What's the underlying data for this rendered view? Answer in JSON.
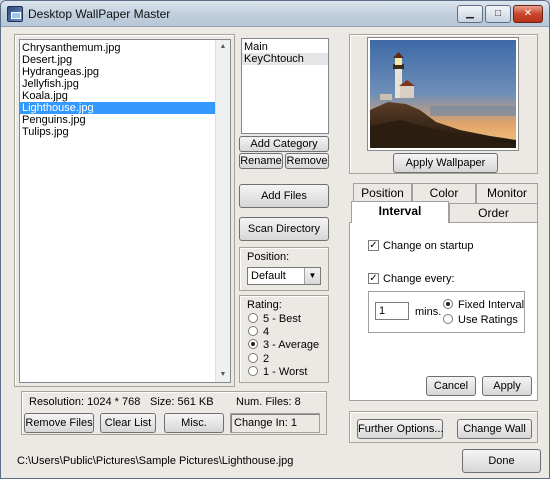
{
  "window": {
    "title": "Desktop WallPaper Master"
  },
  "titlebar_buttons": {
    "minimize": "▁",
    "maximize": "□",
    "close": "✕"
  },
  "files": {
    "items": [
      "Chrysanthemum.jpg",
      "Desert.jpg",
      "Hydrangeas.jpg",
      "Jellyfish.jpg",
      "Koala.jpg",
      "Lighthouse.jpg",
      "Penguins.jpg",
      "Tulips.jpg"
    ],
    "selected_index": 5
  },
  "categories": {
    "items": [
      "Main",
      "KeyChtouch"
    ],
    "selected_index": 1
  },
  "buttons": {
    "add_category": "Add Category",
    "rename": "Rename",
    "remove": "Remove",
    "add_files": "Add Files",
    "scan_directory": "Scan Directory",
    "apply_wallpaper": "Apply Wallpaper",
    "remove_files": "Remove Files",
    "clear_list": "Clear List",
    "misc": "Misc.",
    "cancel": "Cancel",
    "apply": "Apply",
    "further_options": "Further Options...",
    "change_wall": "Change Wall",
    "done": "Done"
  },
  "position": {
    "label": "Position:",
    "value": "Default"
  },
  "rating": {
    "label": "Rating:",
    "options": [
      "5 - Best",
      "4",
      "3 - Average",
      "2",
      "1 - Worst"
    ],
    "selected_index": 2
  },
  "info": {
    "resolution": "Resolution: 1024 * 768",
    "size": "Size: 561 KB",
    "num_files": "Num. Files: 8",
    "change_in": "Change In: 1"
  },
  "tabs": {
    "row1": [
      "Position",
      "Color",
      "Monitor"
    ],
    "row2": [
      "Interval",
      "Order"
    ],
    "active": "Interval"
  },
  "interval": {
    "change_on_startup": "Change on startup",
    "change_on_startup_checked": true,
    "change_every": "Change every:",
    "change_every_checked": true,
    "value": "1",
    "unit": "mins.",
    "mode_options": [
      "Fixed Interval",
      "Use Ratings"
    ],
    "mode_selected_index": 0
  },
  "status_path": "C:\\Users\\Public\\Pictures\\Sample Pictures\\Lighthouse.jpg",
  "preview": {
    "description": "lighthouse-photo"
  },
  "colors": {
    "selection": "#3399ff",
    "window_bg": "#ece9e4"
  }
}
